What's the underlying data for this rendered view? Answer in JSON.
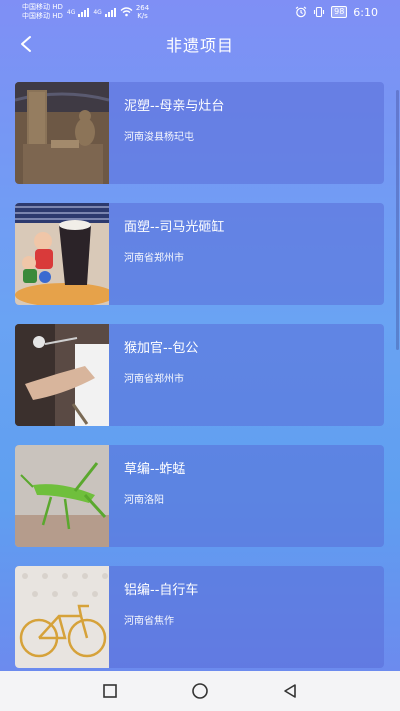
{
  "status": {
    "carrier1": "中国移动 HD",
    "carrier2": "中国移动 HD",
    "net1": "4G",
    "net2": "4G",
    "speed_value": "264",
    "speed_unit": "K/s",
    "battery": "98",
    "time": "6:10"
  },
  "header": {
    "title": "非遗项目"
  },
  "items": [
    {
      "title": "泥塑--母亲与灶台",
      "location": "河南浚县杨玘屯"
    },
    {
      "title": "面塑--司马光砸缸",
      "location": "河南省郑州市"
    },
    {
      "title": "猴加官--包公",
      "location": "河南省郑州市"
    },
    {
      "title": "草编--蚱蜢",
      "location": "河南洛阳"
    },
    {
      "title": "铝编--自行车",
      "location": "河南省焦作"
    }
  ],
  "colors": {
    "bg_top": "#7f8ff5",
    "bg_bottom": "#6f86ee",
    "card": "#6a7edc"
  },
  "icons": {
    "back": "back-arrow-icon",
    "nav_recent": "square-icon",
    "nav_home": "circle-icon",
    "nav_back": "triangle-back-icon"
  }
}
